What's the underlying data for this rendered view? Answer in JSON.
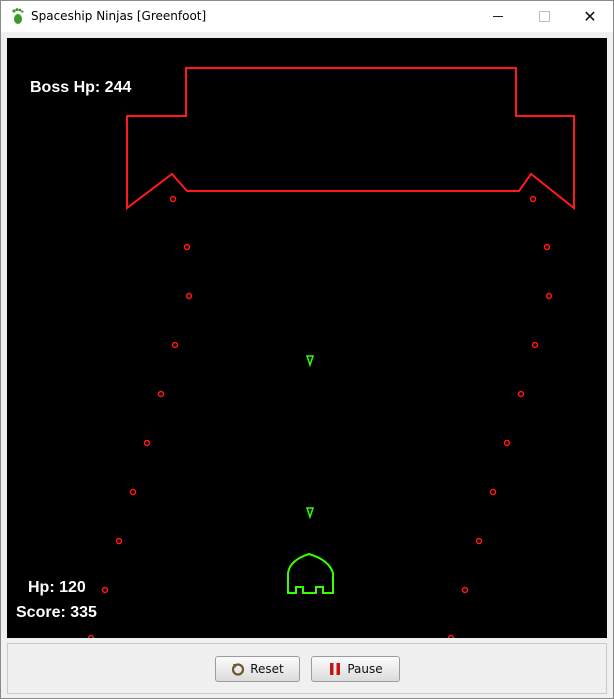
{
  "window": {
    "title": "Spaceship Ninjas [Greenfoot]",
    "app_icon": "greenfoot-footprint-icon",
    "controls": {
      "minimize": "minimize-icon",
      "maximize": "maximize-icon",
      "close_glyph": "✕"
    }
  },
  "hud": {
    "boss_hp": "Boss Hp: 244",
    "player_hp": "Hp: 120",
    "score": "Score: 335"
  },
  "colors": {
    "background": "#000000",
    "boss": "#ff1a1a",
    "boss_bullets": "#ff1a1a",
    "player": "#33ff00",
    "player_bullets": "#33ff00",
    "hud_text": "#ffffff"
  },
  "controls": {
    "reset_label": "Reset",
    "reset_icon": "reset-icon",
    "pause_label": "Pause",
    "pause_icon": "pause-icon"
  }
}
